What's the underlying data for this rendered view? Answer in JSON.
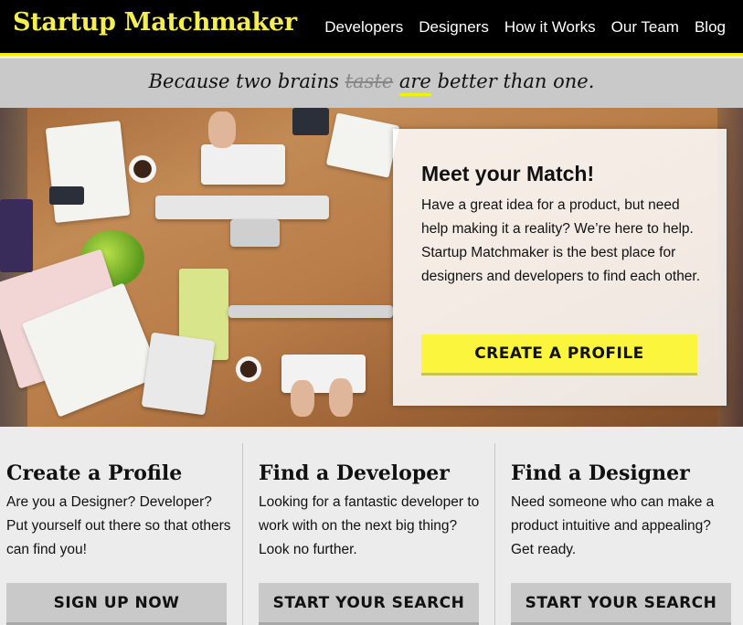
{
  "header": {
    "logo": "Startup Matchmaker",
    "nav": [
      "Developers",
      "Designers",
      "How it Works",
      "Our Team",
      "Blog"
    ]
  },
  "tagline": {
    "prefix": "Because two brains",
    "struck": "taste",
    "emphasis": "are",
    "suffix": "better than one."
  },
  "hero": {
    "title": "Meet your Match!",
    "text": "Have a great idea for a product, but need help making it a reality? We’re here to help. Startup Matchmaker is the best place for designers and developers to find each other.",
    "button": "CREATE A PROFILE"
  },
  "cards": [
    {
      "title": "Create a Profile",
      "text": "Are you a Designer? Developer? Put yourself out there so that others can find you!",
      "button": "SIGN UP NOW"
    },
    {
      "title": "Find a Developer",
      "text": "Looking for a fantastic developer to work with on the next big thing? Look no further.",
      "button": "START YOUR SEARCH"
    },
    {
      "title": "Find a Designer",
      "text": "Need someone who can make a product intuitive and appealing? Get ready.",
      "button": "START YOUR SEARCH"
    }
  ],
  "colors": {
    "header_bg": "#000000",
    "logo": "#f4ee4f",
    "accent_yellow": "#fbf53d",
    "tagline_bg": "#c9c9c9",
    "card_button_bg": "#c9c9c9"
  }
}
